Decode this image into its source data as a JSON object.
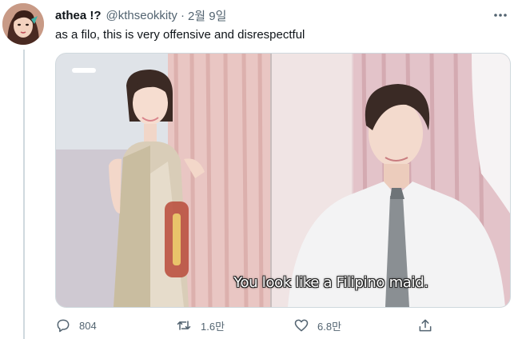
{
  "tweet": {
    "display_name": "athea !?",
    "handle": "@kthseokkity",
    "separator": "·",
    "date": "2월 9일",
    "text": "as a filo, this is very offensive and disrespectful",
    "media": {
      "caption": "You look like a Filipino maid."
    },
    "actions": {
      "reply_count": "804",
      "retweet_count": "1.6만",
      "like_count": "6.8만"
    },
    "icons": {
      "more": "more-dots-icon",
      "reply": "reply-bubble-icon",
      "retweet": "retweet-arrows-icon",
      "like": "heart-icon",
      "share": "share-upload-icon"
    },
    "colors": {
      "text_primary": "#0f1419",
      "text_secondary": "#536471",
      "border": "#cfd9de"
    }
  }
}
